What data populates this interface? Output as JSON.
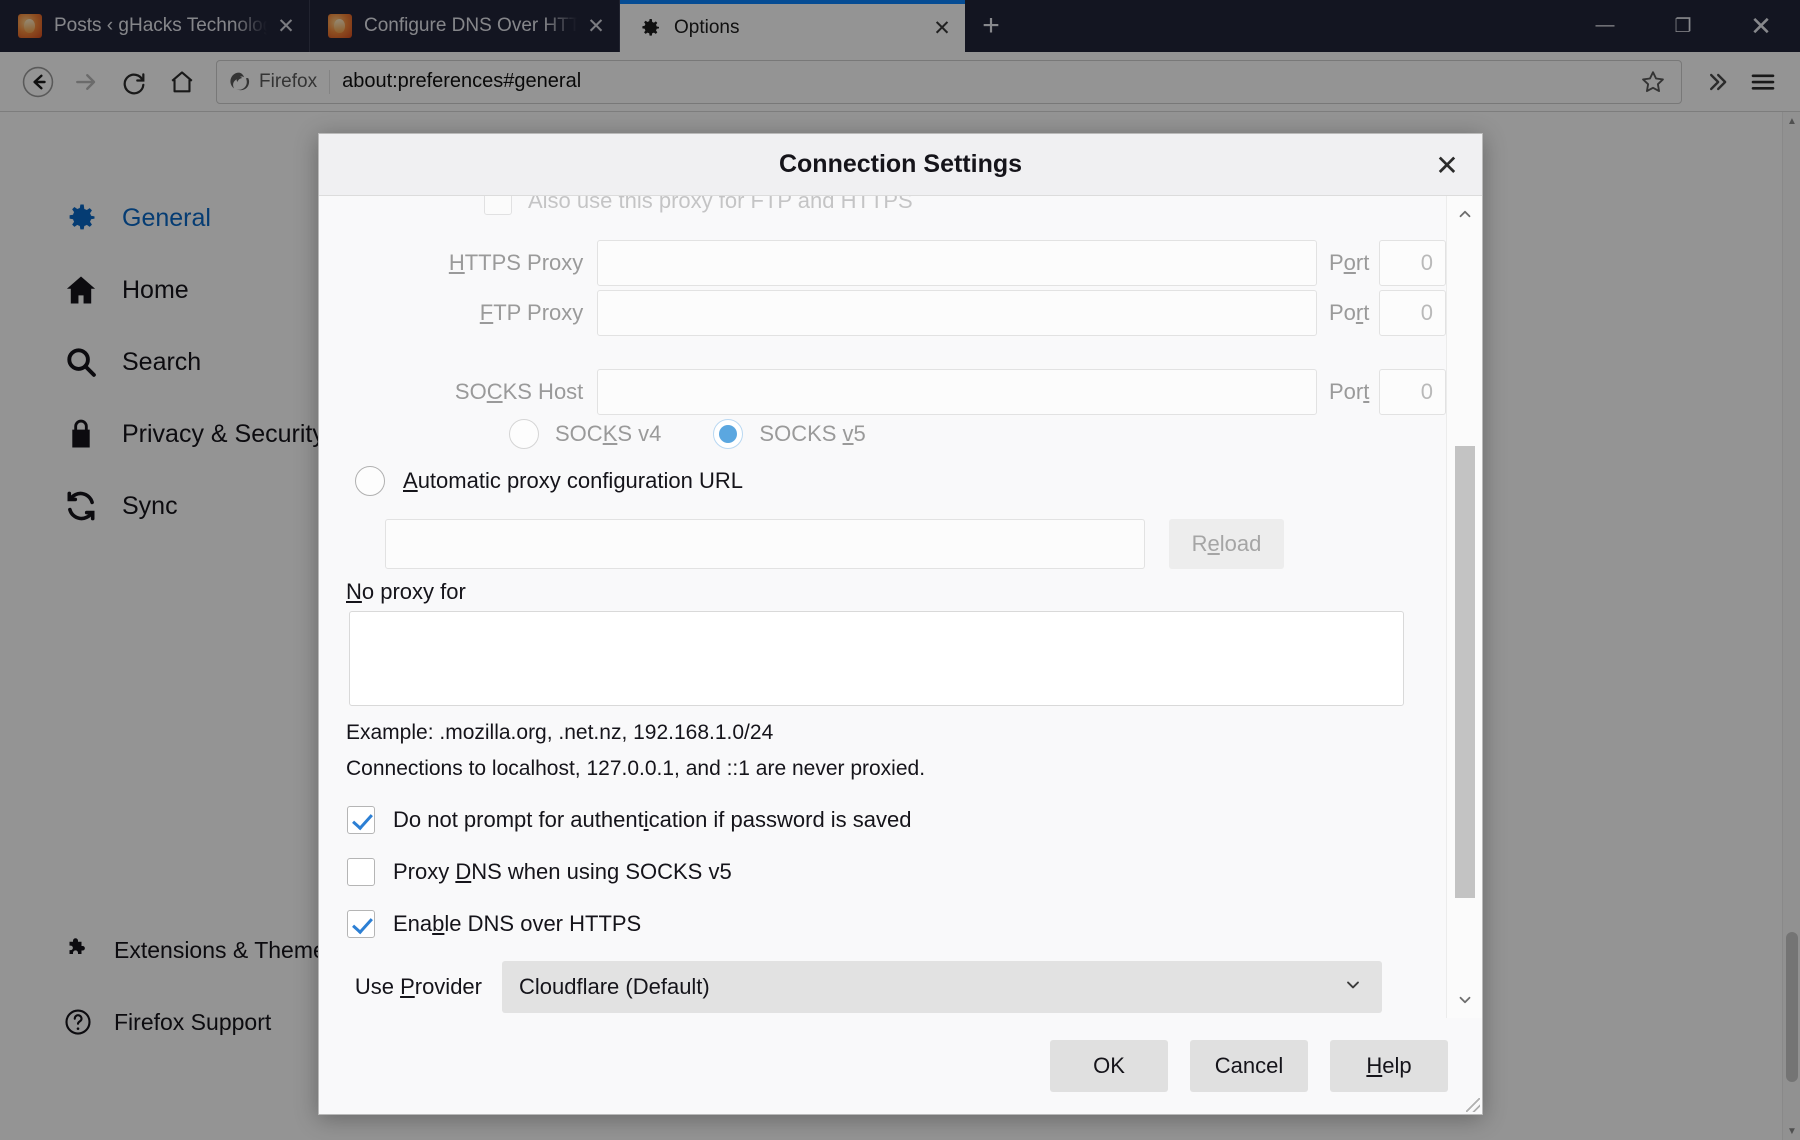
{
  "browser": {
    "tabs": [
      {
        "title": "Posts ‹ gHacks Technology New",
        "favicon": "firefox-favicon",
        "close_label": "✕",
        "active": false
      },
      {
        "title": "Configure DNS Over HTTPS in F",
        "favicon": "firefox-favicon",
        "close_label": "✕",
        "active": false
      },
      {
        "title": "Options",
        "favicon": "gear-icon",
        "close_label": "✕",
        "active": true
      }
    ],
    "new_tab_label": "+",
    "window_controls": {
      "minimize": "—",
      "maximize": "❐",
      "close": "✕"
    },
    "nav": {
      "back": "←",
      "forward": "→",
      "reload": "⟳",
      "home": "⌂",
      "identity_label": "Firefox",
      "url": "about:preferences#general",
      "bookmark_star": "☆",
      "overflow": "»",
      "menu": "☰"
    }
  },
  "preferences": {
    "sidebar": {
      "items": [
        {
          "label": "General",
          "icon": "gear-icon",
          "active": true
        },
        {
          "label": "Home",
          "icon": "home-icon",
          "active": false
        },
        {
          "label": "Search",
          "icon": "search-icon",
          "active": false
        },
        {
          "label": "Privacy & Security",
          "icon": "lock-icon",
          "active": false
        },
        {
          "label": "Sync",
          "icon": "sync-icon",
          "active": false
        }
      ],
      "bottom_items": [
        {
          "label": "Extensions & Themes",
          "icon": "puzzle-icon"
        },
        {
          "label": "Firefox Support",
          "icon": "question-circle-icon"
        }
      ]
    }
  },
  "dialog": {
    "title": "Connection Settings",
    "close_label": "✕",
    "clipped_checkbox": {
      "label": "Also use this proxy for FTP and HTTPS",
      "checked": false
    },
    "proxy_rows": [
      {
        "label": "HTTPS Proxy",
        "accesskey": "H",
        "value": "",
        "port_label": "Port",
        "port_accesskey": "o",
        "port_value": "0"
      },
      {
        "label": "FTP Proxy",
        "accesskey": "F",
        "value": "",
        "port_label": "Port",
        "port_accesskey": "r",
        "port_value": "0"
      },
      {
        "label": "SOCKS Host",
        "accesskey": "C",
        "value": "",
        "port_label": "Port",
        "port_accesskey": "t",
        "port_value": "0"
      }
    ],
    "socks_versions": [
      {
        "label": "SOCKS v4",
        "accesskey": "K",
        "selected": false
      },
      {
        "label": "SOCKS v5",
        "accesskey": "v",
        "selected": true
      }
    ],
    "auto_config": {
      "radio_label": "Automatic proxy configuration URL",
      "accesskey": "A",
      "selected": false,
      "url_value": "",
      "reload_label": "Reload",
      "reload_accesskey": "e",
      "reload_enabled": false
    },
    "no_proxy": {
      "label": "No proxy for",
      "accesskey": "N",
      "value": "",
      "example_text": "Example: .mozilla.org, .net.nz, 192.168.1.0/24",
      "localhost_note": "Connections to localhost, 127.0.0.1, and ::1 are never proxied."
    },
    "checkboxes": [
      {
        "label": "Do not prompt for authentication if password is saved",
        "accesskey": "i",
        "checked": true
      },
      {
        "label": "Proxy DNS when using SOCKS v5",
        "accesskey": "D",
        "checked": false
      },
      {
        "label": "Enable DNS over HTTPS",
        "accesskey": "b",
        "checked": true
      }
    ],
    "provider": {
      "label": "Use Provider",
      "accesskey": "P",
      "selected": "Cloudflare (Default)",
      "chevron": "⌄"
    },
    "buttons": [
      {
        "label": "OK",
        "accesskey": ""
      },
      {
        "label": "Cancel",
        "accesskey": ""
      },
      {
        "label": "Help",
        "accesskey": "H"
      }
    ],
    "scrollbar": {
      "up": "⌃",
      "down": "⌄"
    }
  },
  "colors": {
    "accent_blue": "#0a84ff",
    "tabstrip": "#22253a",
    "sidebar_active": "#0a68c7",
    "radio_fill": "#5ba7e0",
    "check_blue": "#2c7fd4"
  }
}
